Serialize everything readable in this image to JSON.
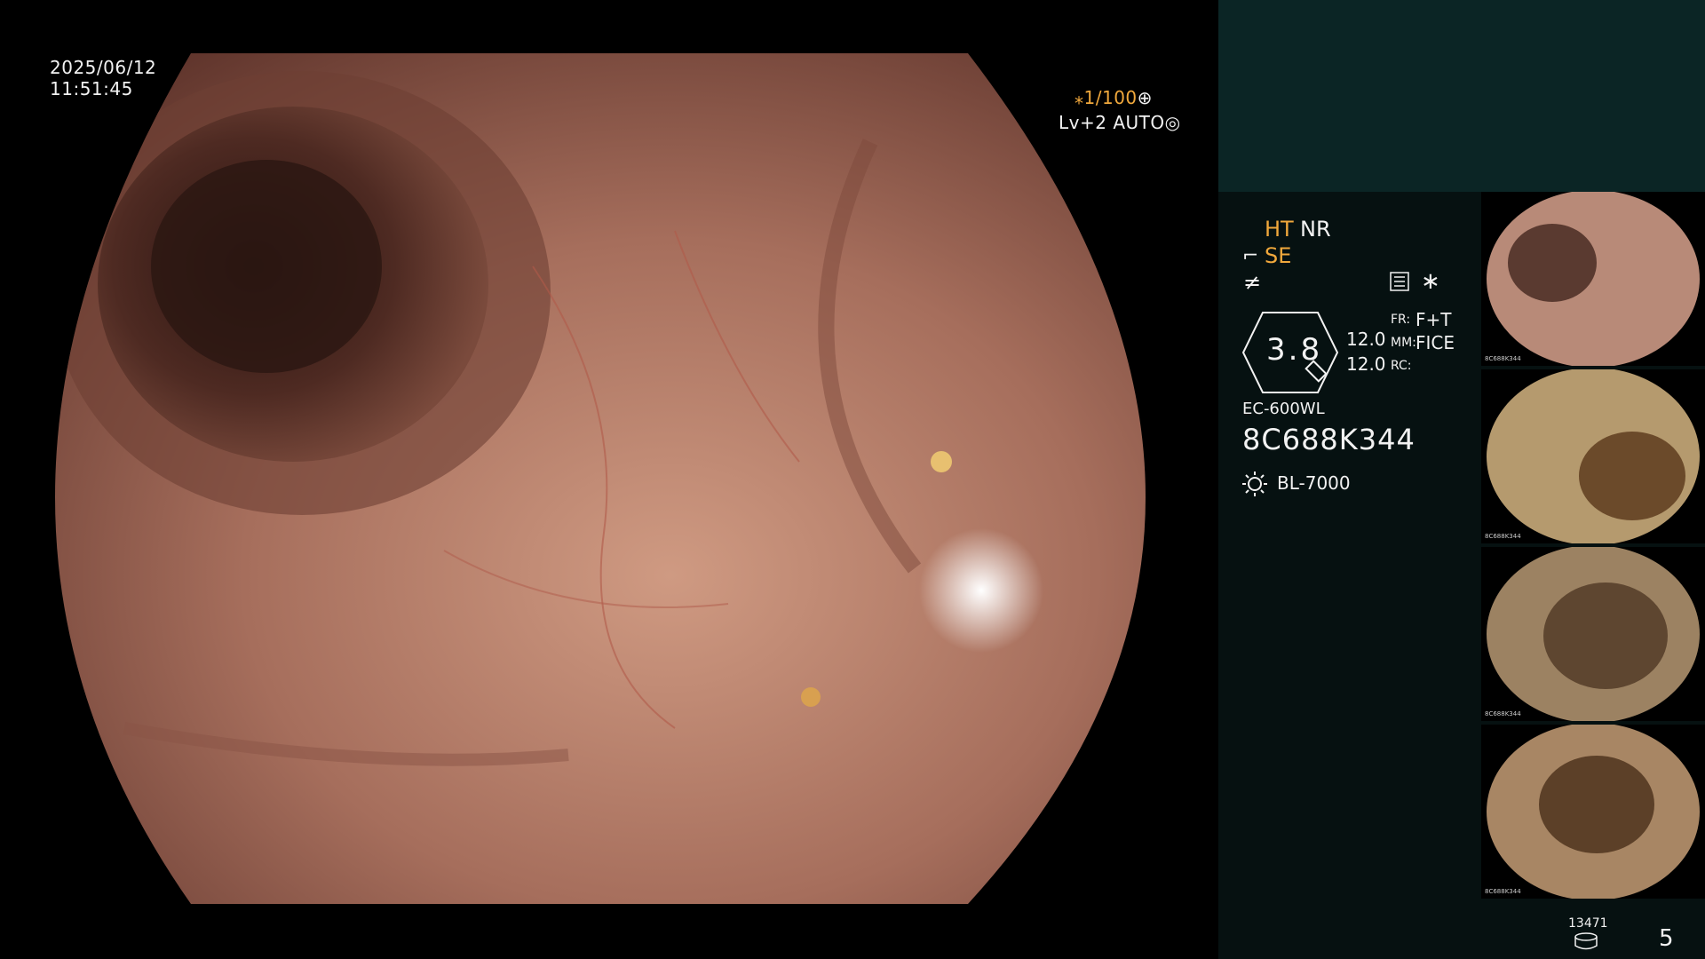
{
  "viewer": {
    "date": "2025/06/12",
    "time": "11:51:45",
    "shutter": "⁎1/100",
    "shutter_icon": "shutter-wheel-icon",
    "iris": "Lv+2 AUTO",
    "iris_icon": "iris-icon"
  },
  "panel": {
    "ht": "HT",
    "nr": "NR",
    "se_icon": "⌐",
    "se": "SE",
    "f_icon": "≠",
    "asterisk": "∗",
    "zoom": "3.8",
    "value_1": "12.0",
    "value_2": "12.0",
    "fr_label": "FR:",
    "fr_value": "F+T",
    "mm_label": "MM:",
    "mm_value": "FICE",
    "rc_label": "RC:",
    "scope_model": "EC-600WL",
    "serial": "8C688K344",
    "light_model": "BL-7000",
    "counter": "13471",
    "page_number": "5"
  },
  "colors": {
    "accent": "#f0a83c",
    "panel_bg": "#061111",
    "panel_top_bg": "#0b2525"
  },
  "thumbnails": [
    {
      "tone": "#b88a78",
      "lumen": "#5a3a30"
    },
    {
      "tone": "#b59a6e",
      "lumen": "#6b4a2a"
    },
    {
      "tone": "#9c8262",
      "lumen": "#5e4630"
    },
    {
      "tone": "#a88664",
      "lumen": "#5c4028"
    }
  ]
}
